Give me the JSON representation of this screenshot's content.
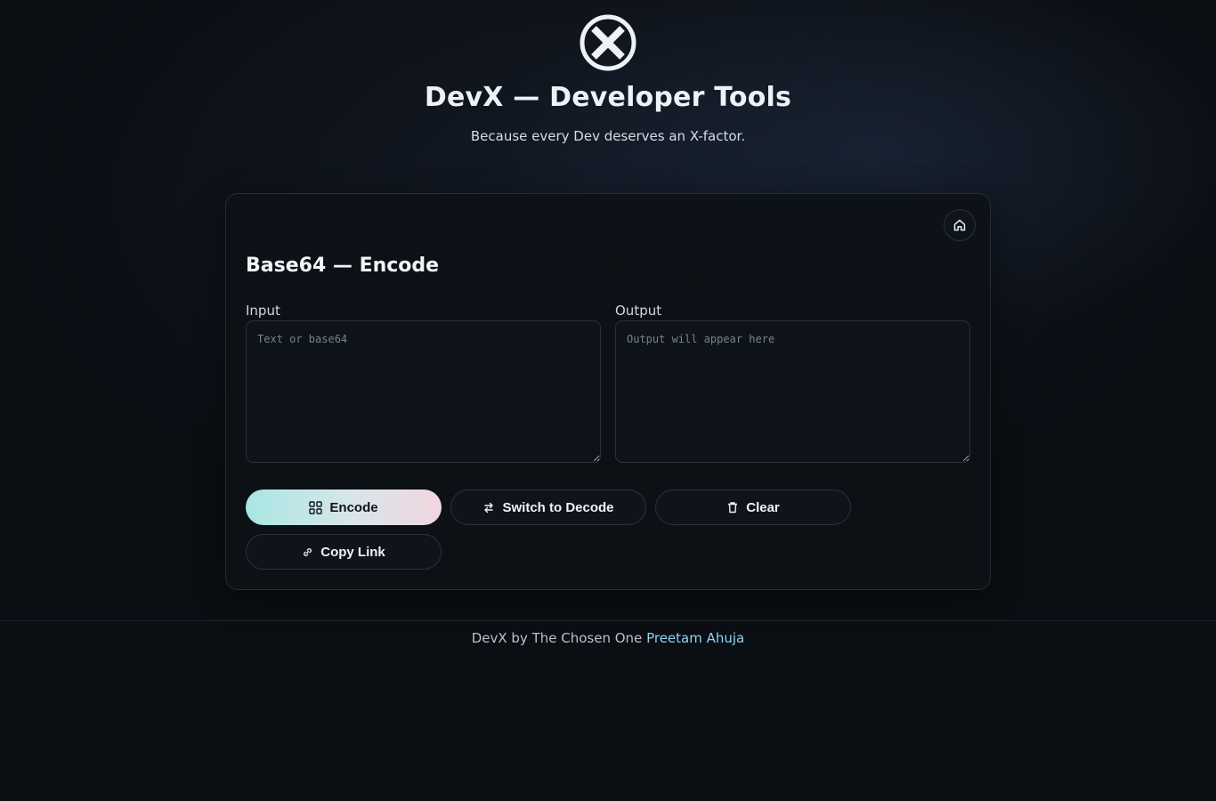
{
  "header": {
    "title": "DevX — Developer Tools",
    "subtitle": "Because every Dev deserves an X-factor."
  },
  "card": {
    "title": "Base64 — Encode",
    "input_label": "Input",
    "output_label": "Output",
    "input_placeholder": "Text or base64",
    "output_placeholder": "Output will appear here",
    "input_value": "",
    "output_value": "",
    "buttons": {
      "encode": "Encode",
      "switch": "Switch to Decode",
      "clear": "Clear",
      "copy_link": "Copy Link"
    }
  },
  "footer": {
    "text": "DevX by The Chosen One",
    "author": "Preetam Ahuja"
  },
  "colors": {
    "background": "#0b0e13",
    "accent_link": "#8fd3f4",
    "primary_gradient_start": "#a8e6e3",
    "primary_gradient_end": "#f1d5df"
  },
  "icons": {
    "logo": "x-circle-logo",
    "home": "home-icon",
    "encode": "grid-icon",
    "switch": "swap-arrows-icon",
    "clear": "trash-icon",
    "copy_link": "link-icon"
  }
}
